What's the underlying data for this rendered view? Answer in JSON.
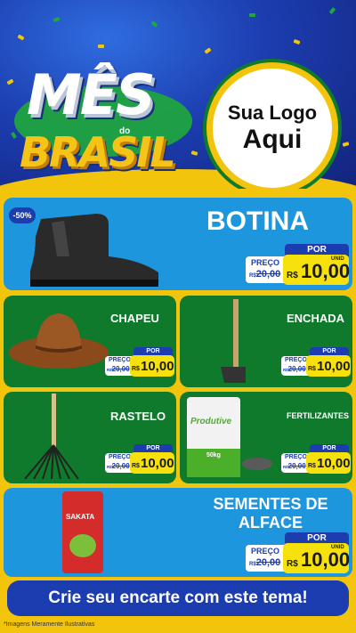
{
  "header": {
    "title_line1": "MÊS",
    "title_small": "do",
    "title_line2": "BRASIL",
    "logo_line1": "Sua Logo",
    "logo_line2": "Aqui"
  },
  "products": [
    {
      "name": "BOTINA",
      "discount": "-50%",
      "por": "POR",
      "preco": "PREÇO",
      "old_currency": "R$",
      "old_price": "20,00",
      "currency": "R$",
      "price": "10,00",
      "unit": "UNID"
    },
    {
      "name": "CHAPEU",
      "por": "POR",
      "preco": "PREÇO",
      "old_currency": "R$",
      "old_price": "20,00",
      "currency": "R$",
      "price": "10,00"
    },
    {
      "name": "ENCHADA",
      "por": "POR",
      "preco": "PREÇO",
      "old_currency": "R$",
      "old_price": "20,00",
      "currency": "R$",
      "price": "10,00"
    },
    {
      "name": "RASTELO",
      "por": "POR",
      "preco": "PREÇO",
      "old_currency": "R$",
      "old_price": "20,00",
      "currency": "R$",
      "price": "10,00"
    },
    {
      "name": "FERTILIZANTES",
      "por": "POR",
      "preco": "PREÇO",
      "old_currency": "R$",
      "old_price": "20,00",
      "currency": "R$",
      "price": "10,00",
      "bag_brand": "Produtive",
      "bag_weight": "50kg"
    },
    {
      "name_line1": "SEMENTES DE",
      "name_line2": "ALFACE",
      "por": "POR",
      "preco": "PREÇO",
      "old_currency": "R$",
      "old_price": "20,00",
      "currency": "R$",
      "price": "10,00",
      "unit": "UNID",
      "pack_brand": "SAKATA"
    }
  ],
  "footer": {
    "cta": "Crie seu encarte com este tema!",
    "note": "*Imagens Meramente Ilustrativas"
  },
  "colors": {
    "blue_dark": "#1c3db0",
    "blue_light": "#1e96dd",
    "green": "#0f7a2b",
    "yellow": "#f2c40c",
    "price_yellow": "#f6e10c"
  }
}
